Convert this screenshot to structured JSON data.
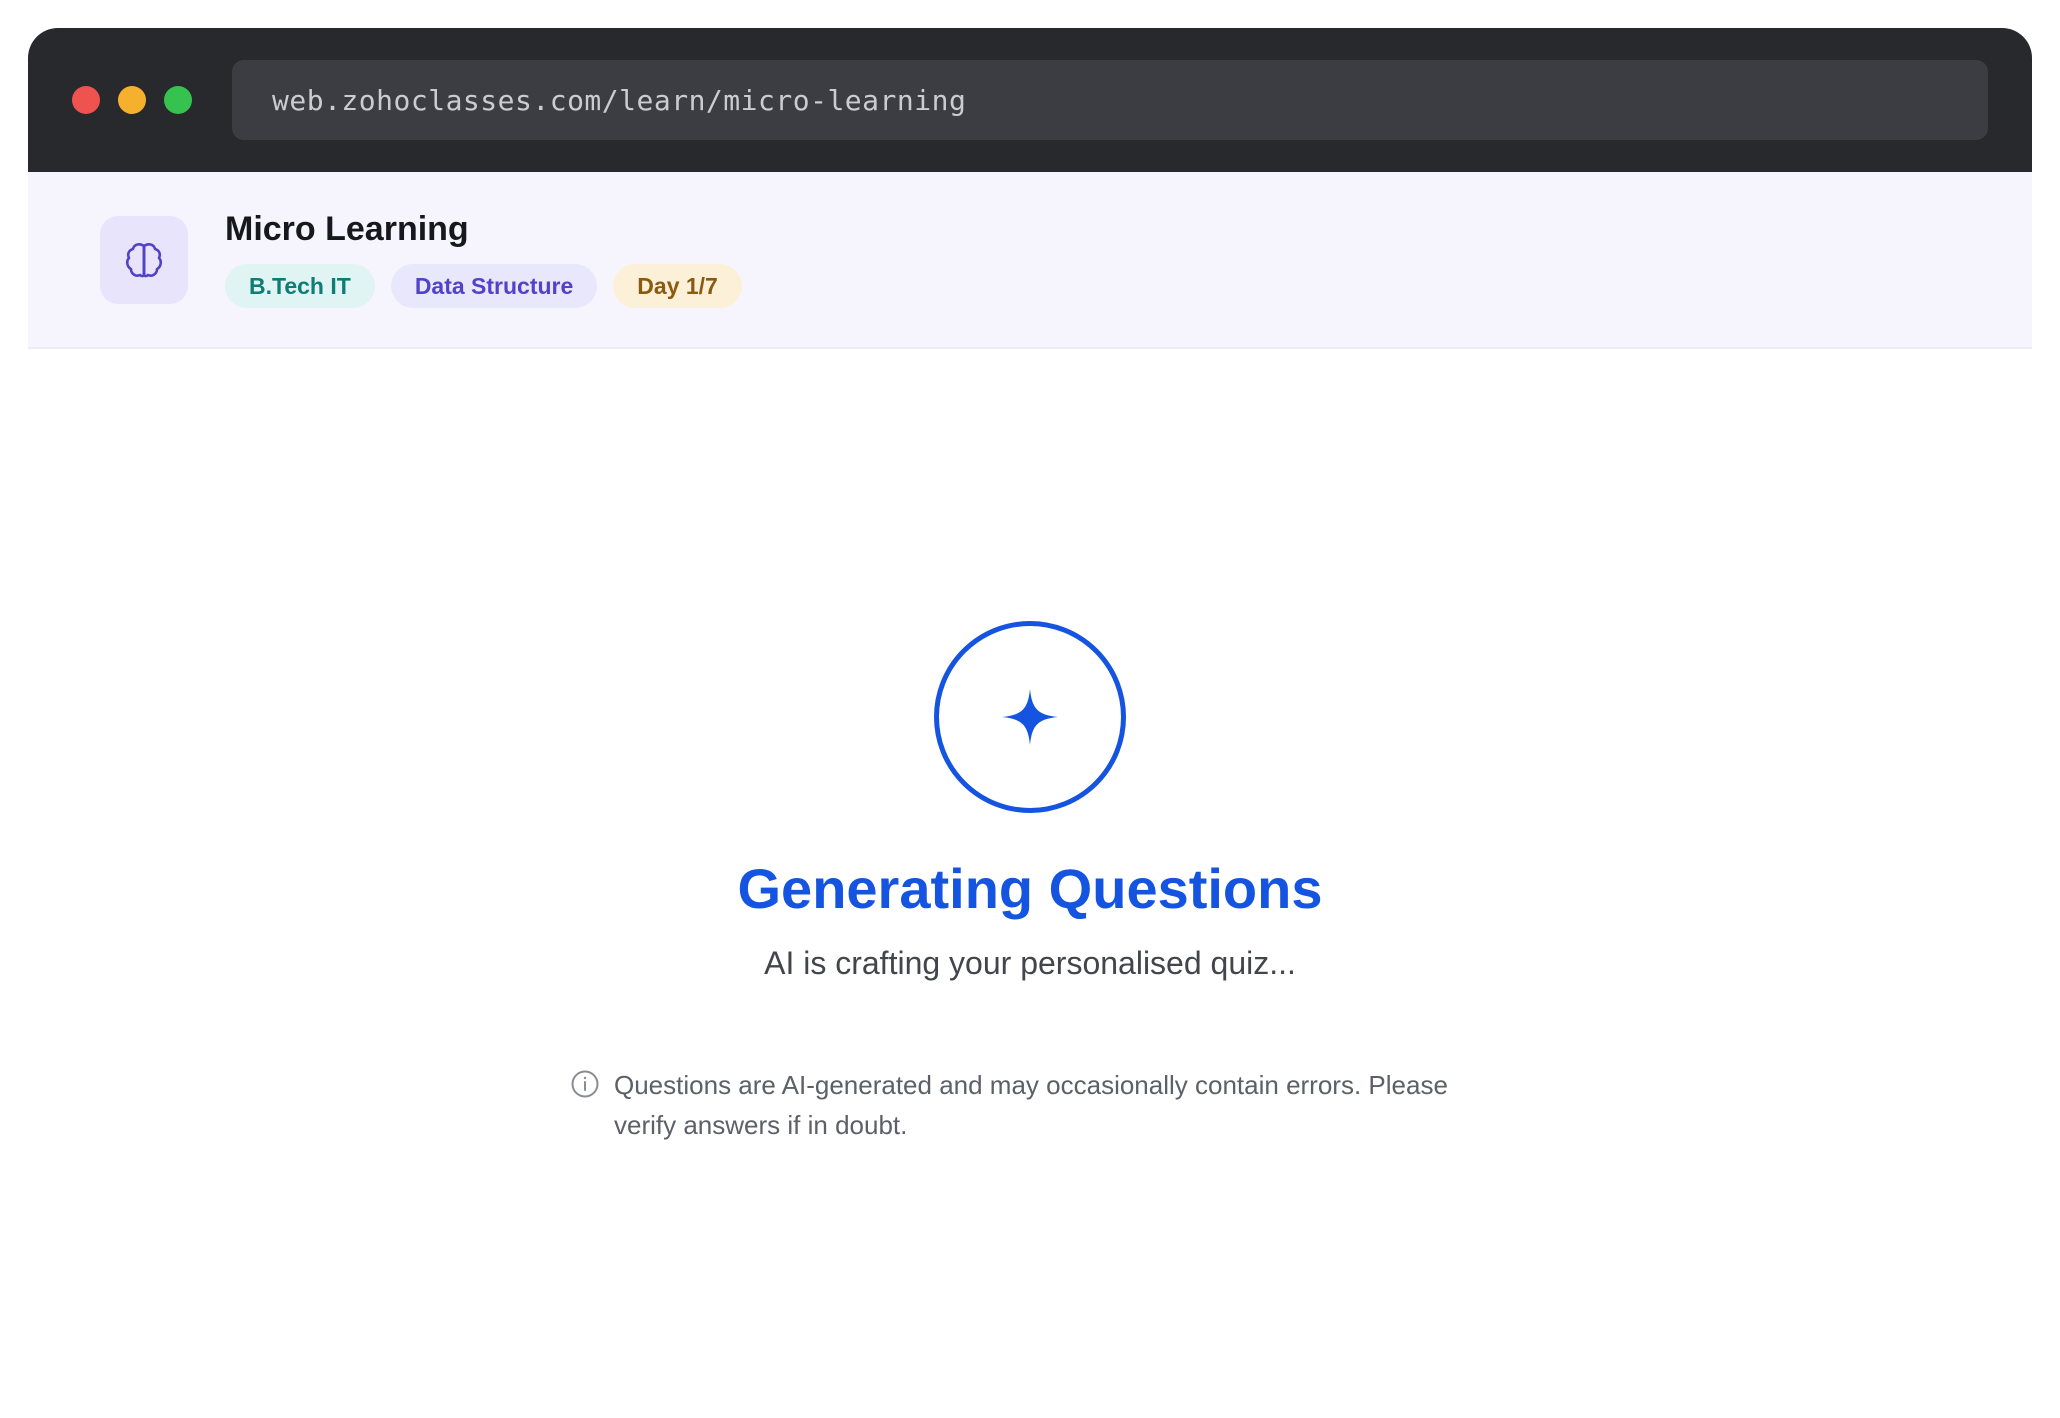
{
  "browser": {
    "url": "web.zohoclasses.com/learn/micro-learning"
  },
  "header": {
    "icon": "brain-icon",
    "title": "Micro Learning",
    "tags": [
      {
        "label": "B.Tech IT",
        "color": "#0f7c76"
      },
      {
        "label": "Data Structure",
        "color": "#5142c9"
      },
      {
        "label": "Day 1/7",
        "color": "#8a5a0e"
      }
    ]
  },
  "status": {
    "icon": "sparkle-icon",
    "title": "Generating Questions",
    "subtitle": "AI is crafting your personalised quiz...",
    "accent_color": "#1454e0"
  },
  "notice": {
    "icon": "info-icon",
    "text": "Questions are AI-generated and may occasionally contain errors. Please verify answers if in doubt."
  }
}
